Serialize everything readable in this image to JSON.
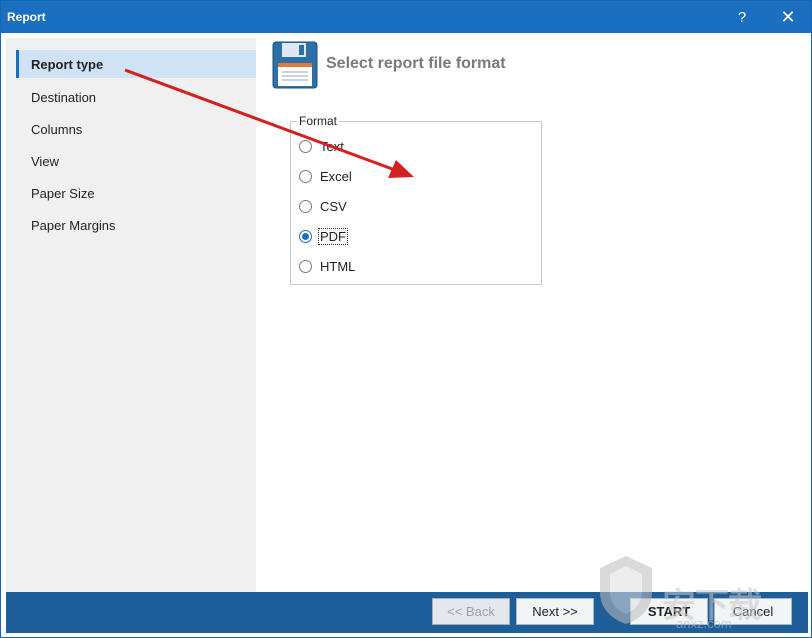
{
  "window": {
    "title": "Report"
  },
  "titlebar": {
    "help_label": "?",
    "close_label": "✕"
  },
  "sidebar": {
    "items": [
      {
        "label": "Report type",
        "active": true
      },
      {
        "label": "Destination"
      },
      {
        "label": "Columns"
      },
      {
        "label": "View"
      },
      {
        "label": "Paper Size"
      },
      {
        "label": "Paper Margins"
      }
    ]
  },
  "main": {
    "header": {
      "icon": "floppy-disk-icon",
      "title": "Select report file format"
    },
    "format_group": {
      "label": "Format",
      "options": [
        {
          "label": "Text",
          "checked": false
        },
        {
          "label": "Excel",
          "checked": false
        },
        {
          "label": "CSV",
          "checked": false
        },
        {
          "label": "PDF",
          "checked": true
        },
        {
          "label": "HTML",
          "checked": false
        }
      ]
    }
  },
  "footer": {
    "back_label": "<< Back",
    "next_label": "Next >>",
    "start_label": "START",
    "cancel_label": "Cancel"
  },
  "colors": {
    "accent": "#1a6fc0",
    "footer": "#1f5f99",
    "sidebar_bg": "#f0f0f0",
    "active_item": "#cfe3f5",
    "arrow": "#d42020"
  },
  "watermark": {
    "text": "安下载",
    "subtext": "anxz.com"
  }
}
